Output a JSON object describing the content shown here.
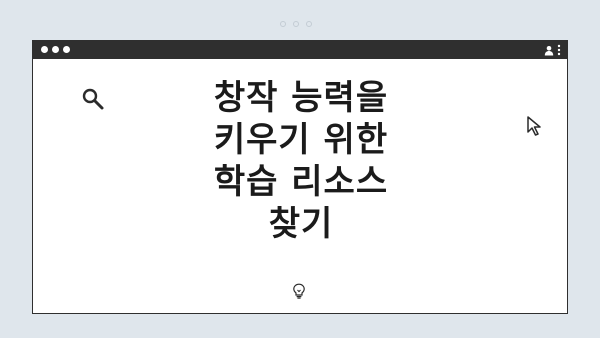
{
  "window": {
    "title_bar": {
      "traffic_lights": [
        "close",
        "minimize",
        "maximize"
      ],
      "right_icons": [
        "user-icon",
        "more-options-icon"
      ]
    }
  },
  "content": {
    "headline": "창작 능력을\n키우기 위한\n학습 리소스\n찾기",
    "icons": [
      "search-icon",
      "cursor-icon",
      "lightbulb-icon"
    ]
  },
  "colors": {
    "background": "#dfe6ec",
    "titlebar": "#2f2f2f",
    "window": "#ffffff",
    "text": "#1b1b1b"
  }
}
